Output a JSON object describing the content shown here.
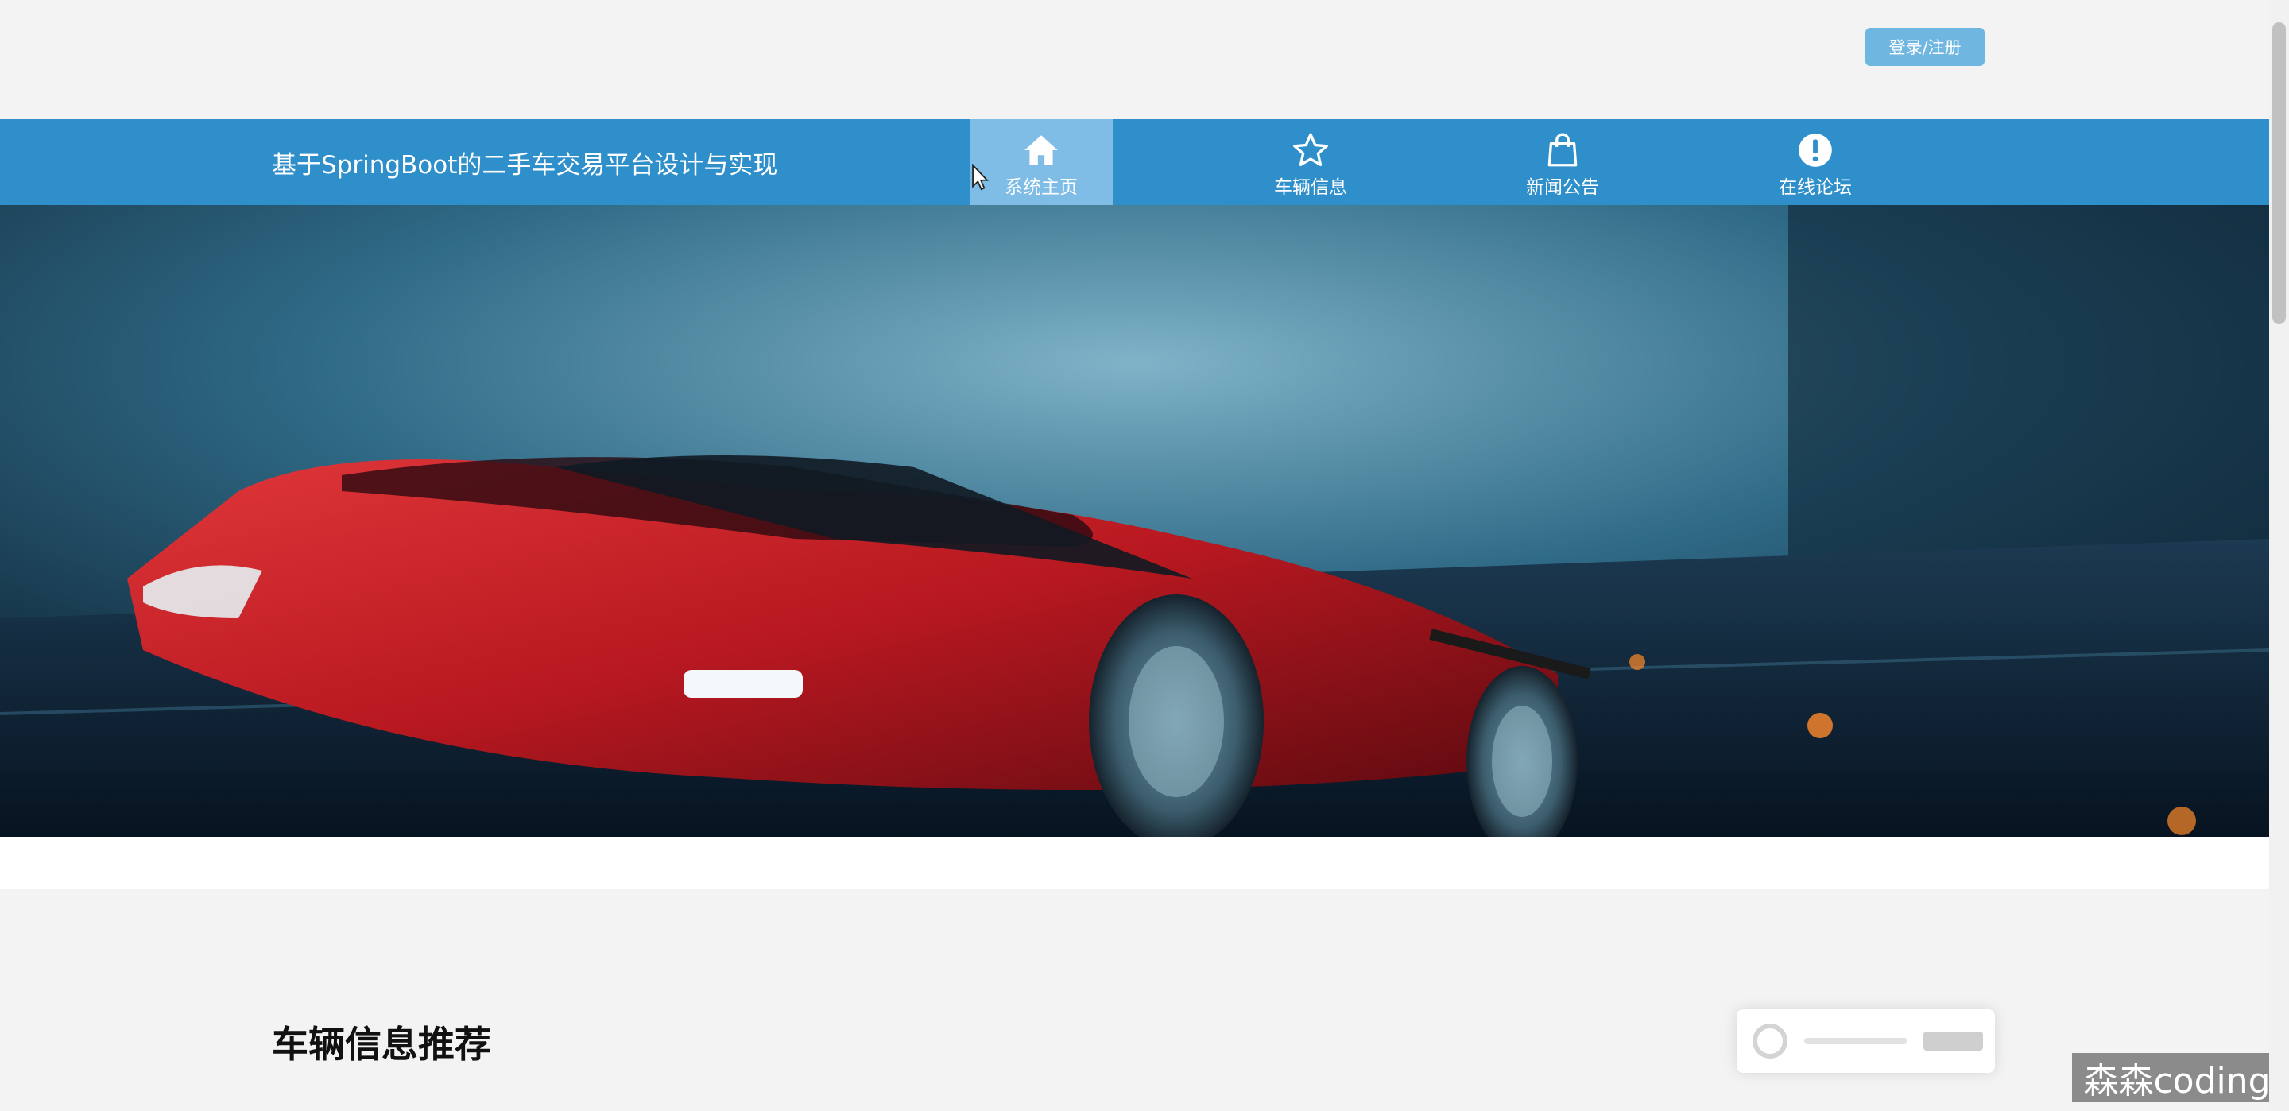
{
  "header": {
    "login_label": "登录/注册"
  },
  "nav": {
    "site_title": "基于SpringBoot的二手车交易平台设计与实现",
    "items": [
      {
        "label": "系统主页",
        "icon": "home-icon"
      },
      {
        "label": "车辆信息",
        "icon": "star-icon"
      },
      {
        "label": "新闻公告",
        "icon": "shopping-bag-icon"
      },
      {
        "label": "在线论坛",
        "icon": "exclamation-circle-icon"
      }
    ],
    "active_index": 0
  },
  "banner": {
    "image": "red sports car driving on a dark forest road",
    "slide_count": 3,
    "active_slide": 1
  },
  "section": {
    "title": "车辆信息推荐"
  },
  "watermark": "森森coding",
  "colors": {
    "nav_bg": "#2f8fcb",
    "nav_active": "#7fbde6",
    "login_btn": "#6fb6e1",
    "page_bg": "#f3f3f3"
  }
}
